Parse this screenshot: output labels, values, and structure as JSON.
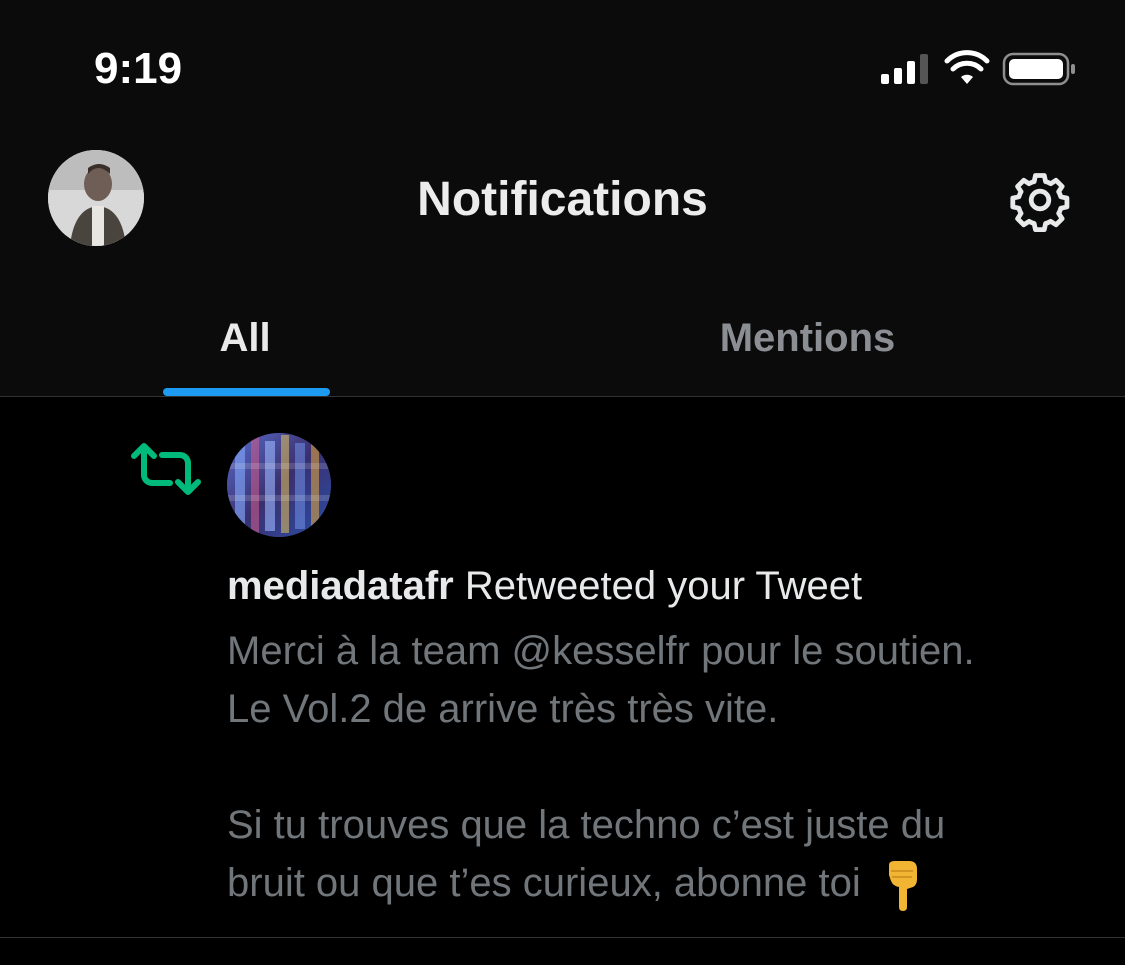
{
  "status_bar": {
    "time": "9:19",
    "icons": [
      "cellular-signal-icon",
      "wifi-icon",
      "battery-icon"
    ]
  },
  "header": {
    "title": "Notifications",
    "avatar_icon": "profile-avatar",
    "settings_icon": "gear-icon"
  },
  "tabs": [
    {
      "label": "All",
      "active": true
    },
    {
      "label": "Mentions",
      "active": false
    }
  ],
  "notification": {
    "type_icon": "retweet-icon",
    "user": "mediadatafr",
    "action": "Retweeted your Tweet",
    "tweet_lines": [
      "Merci à la team @kesselfr pour le soutien.",
      "Le Vol.2 de arrive très très vite.",
      "",
      "Si tu trouves que la techno c’est juste du",
      "bruit ou que t’es curieux, abonne toi"
    ],
    "emoji": "👇"
  },
  "colors": {
    "accent": "#1d9bf0",
    "retweet": "#00ba7c",
    "muted_text": "#71767b",
    "primary_text": "#e7e9ea",
    "divider": "#2f3336"
  }
}
